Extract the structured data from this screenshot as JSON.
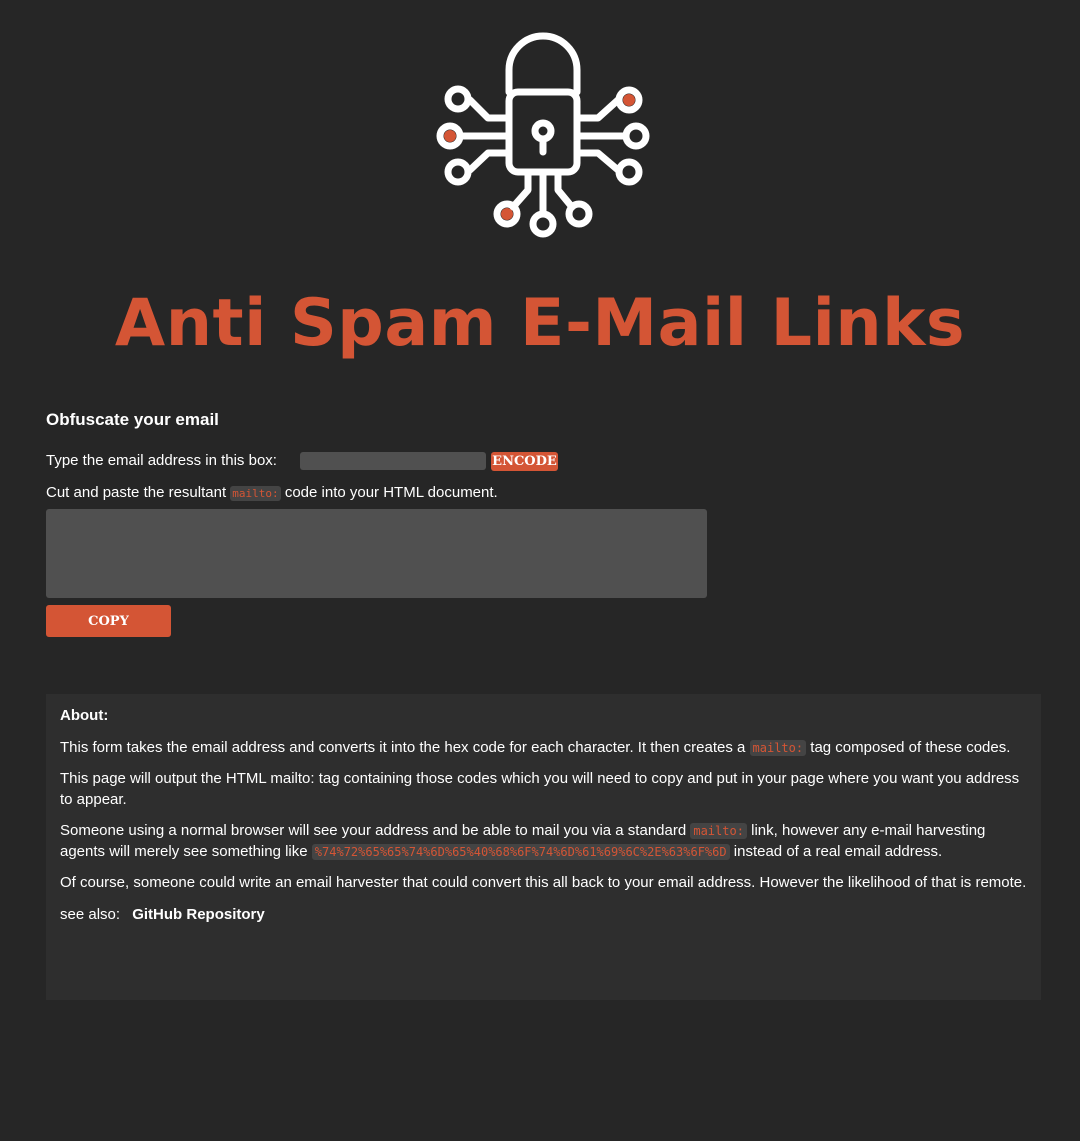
{
  "brand": {
    "accent_color": "#d45535",
    "logo_icon": "padlock-circuit-icon"
  },
  "title": "Anti Spam E-Mail Links",
  "form": {
    "heading": "Obfuscate your email",
    "email_prompt": "Type the email address in this box:",
    "email_value": "",
    "encode_label": "ENCODE",
    "cut_prefix": "Cut and paste the resultant",
    "cut_code": "mailto:",
    "cut_suffix": "code into your HTML document.",
    "output_value": "",
    "copy_label": "COPY"
  },
  "about": {
    "heading": "About:",
    "p1_prefix": "This form takes the email address and converts it into the hex code for each character. It then creates a",
    "p1_code": "mailto:",
    "p1_suffix": "tag composed of these codes.",
    "p2": "This page will output the HTML mailto: tag containing those codes which you will need to copy and put in your page where you want you address to appear.",
    "p3_prefix": "Someone using a normal browser will see your address and be able to mail you via a standard",
    "p3_code": "mailto:",
    "p3_middle": "link, however any e-mail harvesting agents will merely see something like",
    "p3_code2": "%74%72%65%65%74%6D%65%40%68%6F%74%6D%61%69%6C%2E%63%6F%6D",
    "p3_suffix": "instead of a real email address.",
    "p4": "Of course, someone could write an email harvester that could convert this all back to your email address. However the likelihood of that is remote.",
    "see_also_label": "see also:",
    "see_also_link": "GitHub Repository"
  }
}
